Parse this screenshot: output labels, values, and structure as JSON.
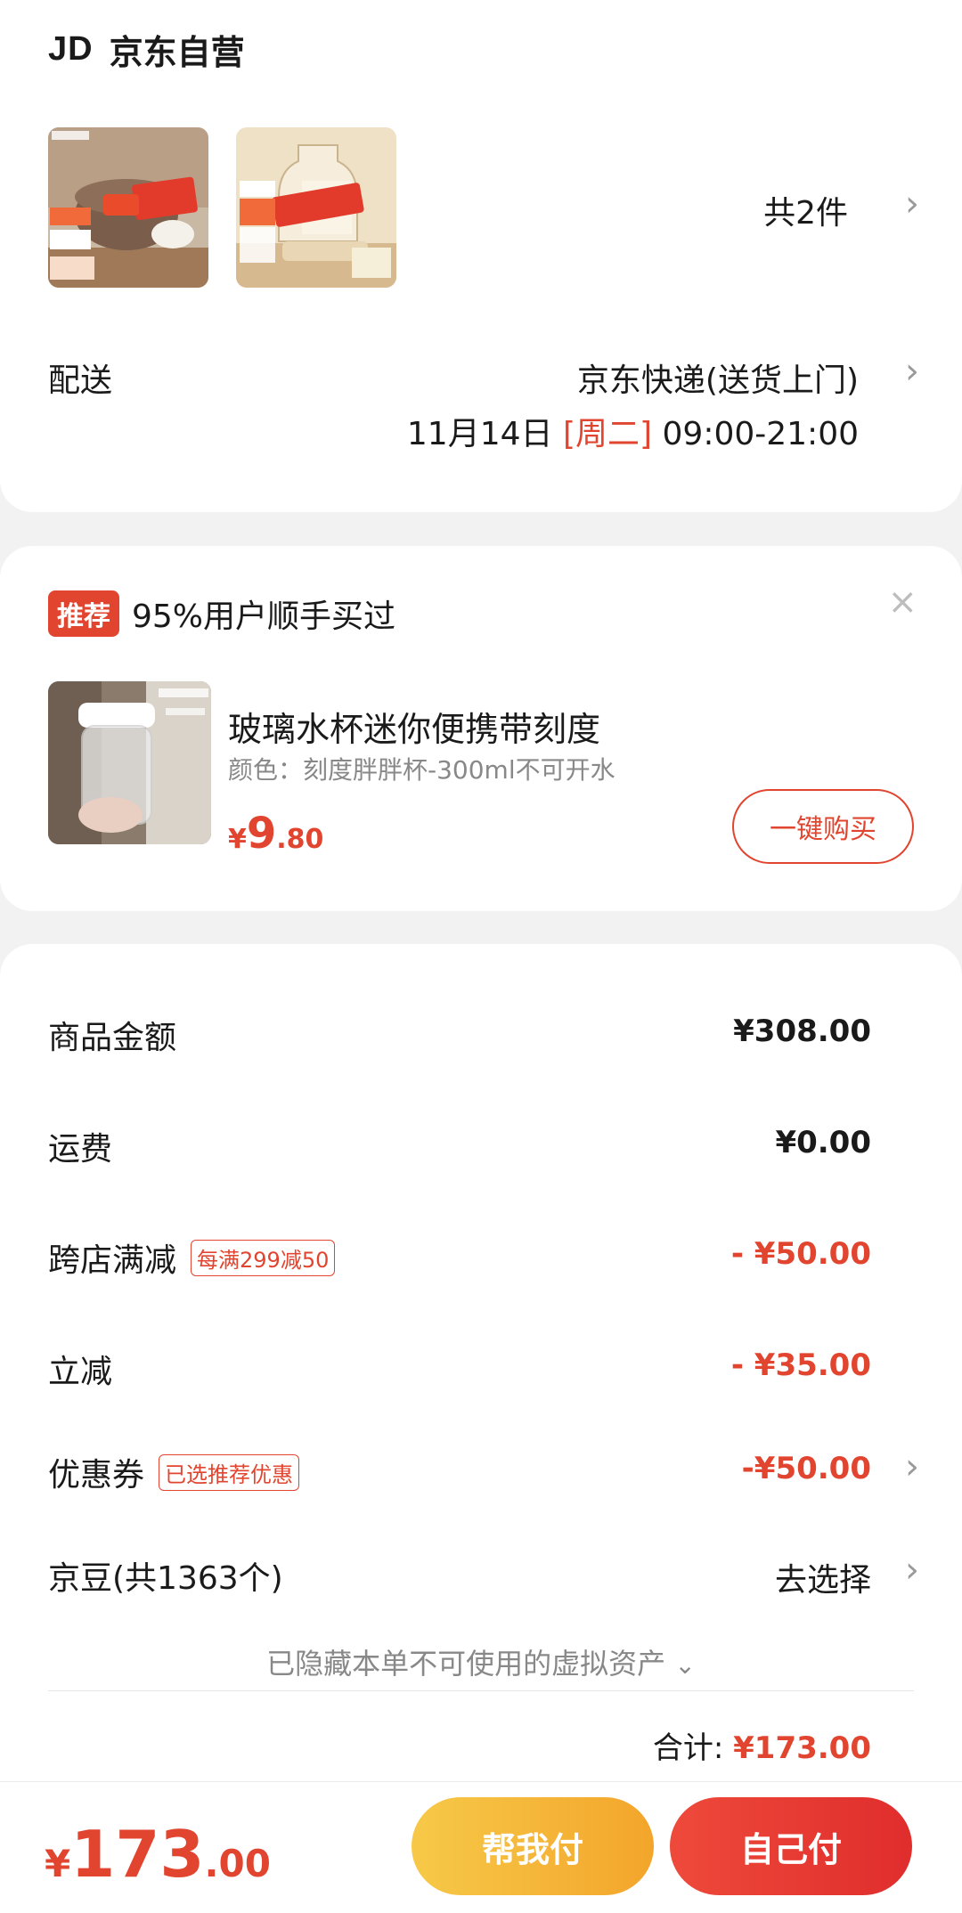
{
  "store": {
    "logo": "JD",
    "name": "京东自营"
  },
  "items": {
    "count_label": "共2件"
  },
  "shipping": {
    "label": "配送",
    "method": "京东快递(送货上门)",
    "date": "11月14日",
    "day": "[周二]",
    "time": "09:00-21:00"
  },
  "recommend": {
    "badge": "推荐",
    "title": "95%用户顺手买过",
    "close_icon": "×",
    "product_name": "玻璃水杯迷你便携带刻度",
    "product_spec": "颜色：刻度胖胖杯-300ml不可开水",
    "price_currency": "¥",
    "price_int": "9",
    "price_dec": ".80",
    "buy_label": "一键购买"
  },
  "summary": {
    "rows": [
      {
        "label": "商品金额",
        "value": "¥308.00"
      },
      {
        "label": "运费",
        "value": "¥0.00"
      },
      {
        "label": "跨店满减",
        "tag": "每满299减50",
        "value": "- ¥50.00"
      },
      {
        "label": "立减",
        "value": "- ¥35.00"
      },
      {
        "label": "优惠券",
        "tag": "已选推荐优惠",
        "value": "-¥50.00"
      },
      {
        "label": "京豆(共1363个)",
        "value": "去选择"
      }
    ],
    "hidden_assets": "已隐藏本单不可使用的虚拟资产",
    "total_label": "合计:",
    "total_value": "¥173.00"
  },
  "bottom": {
    "currency": "¥",
    "price_int": "173",
    "price_dec": ".00",
    "help_pay": "帮我付",
    "self_pay": "自己付"
  },
  "colors": {
    "accent": "#e2452f",
    "help_btn": "#f3b33a",
    "self_btn": "#e63a33"
  }
}
